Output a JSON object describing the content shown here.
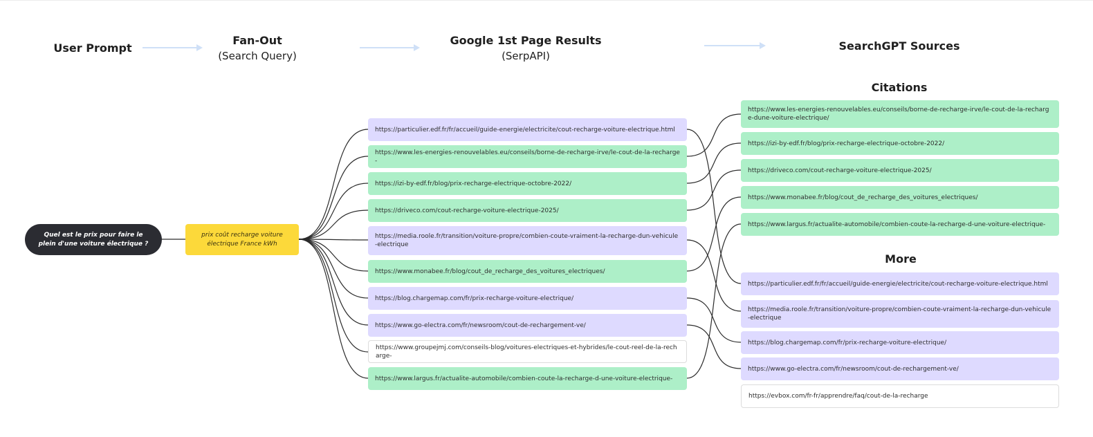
{
  "headers": {
    "user_prompt": "User Prompt",
    "fanout_title": "Fan-Out",
    "fanout_sub": "(Search Query)",
    "google_title": "Google 1st Page Results",
    "google_sub": "(SerpAPI)",
    "searchgpt_title": "SearchGPT Sources"
  },
  "prompt": "Quel est le prix pour faire le plein d'une voiture électrique ?",
  "query": "prix coût recharge voiture électrique France kWh",
  "colors": {
    "purple": "#dedaff",
    "green": "#adefc8",
    "white": "#ffffff",
    "yellow": "#fcd93a",
    "dark": "#2b2c32",
    "arrow": "#cfe0f7"
  },
  "google_results": [
    {
      "url": "https://particulier.edf.fr/fr/accueil/guide-energie/electricite/cout-recharge-voiture-electrique.html",
      "color": "purple"
    },
    {
      "url": "https://www.les-energies-renouvelables.eu/conseils/borne-de-recharge-irve/le-cout-de-la-recharge-",
      "color": "green"
    },
    {
      "url": "https://izi-by-edf.fr/blog/prix-recharge-electrique-octobre-2022/",
      "color": "green"
    },
    {
      "url": "https://driveco.com/cout-recharge-voiture-electrique-2025/",
      "color": "green"
    },
    {
      "url": "https://media.roole.fr/transition/voiture-propre/combien-coute-vraiment-la-recharge-dun-vehicule-electrique",
      "color": "purple"
    },
    {
      "url": "https://www.monabee.fr/blog/cout_de_recharge_des_voitures_electriques/",
      "color": "green"
    },
    {
      "url": "https://blog.chargemap.com/fr/prix-recharge-voiture-electrique/",
      "color": "purple"
    },
    {
      "url": "https://www.go-electra.com/fr/newsroom/cout-de-rechargement-ve/",
      "color": "purple"
    },
    {
      "url": "https://www.groupejmj.com/conseils-blog/voitures-electriques-et-hybrides/le-cout-reel-de-la-recharge-",
      "color": "white"
    },
    {
      "url": "https://www.largus.fr/actualite-automobile/combien-coute-la-recharge-d-une-voiture-electrique-",
      "color": "green"
    }
  ],
  "citations_title": "Citations",
  "citations": [
    {
      "url": "https://www.les-energies-renouvelables.eu/conseils/borne-de-recharge-irve/le-cout-de-la-recharge-dune-voiture-electrique/",
      "color": "green"
    },
    {
      "url": "https://izi-by-edf.fr/blog/prix-recharge-electrique-octobre-2022/",
      "color": "green"
    },
    {
      "url": "https://driveco.com/cout-recharge-voiture-electrique-2025/",
      "color": "green"
    },
    {
      "url": "https://www.monabee.fr/blog/cout_de_recharge_des_voitures_electriques/",
      "color": "green"
    },
    {
      "url": "https://www.largus.fr/actualite-automobile/combien-coute-la-recharge-d-une-voiture-electrique-",
      "color": "green"
    }
  ],
  "more_title": "More",
  "more": [
    {
      "url": "https://particulier.edf.fr/fr/accueil/guide-energie/electricite/cout-recharge-voiture-electrique.html",
      "color": "purple"
    },
    {
      "url": "https://media.roole.fr/transition/voiture-propre/combien-coute-vraiment-la-recharge-dun-vehicule-electrique",
      "color": "purple"
    },
    {
      "url": "https://blog.chargemap.com/fr/prix-recharge-voiture-electrique/",
      "color": "purple"
    },
    {
      "url": "https://www.go-electra.com/fr/newsroom/cout-de-rechargement-ve/",
      "color": "purple"
    },
    {
      "url": "https://evbox.com/fr-fr/apprendre/faq/cout-de-la-recharge",
      "color": "white"
    }
  ]
}
